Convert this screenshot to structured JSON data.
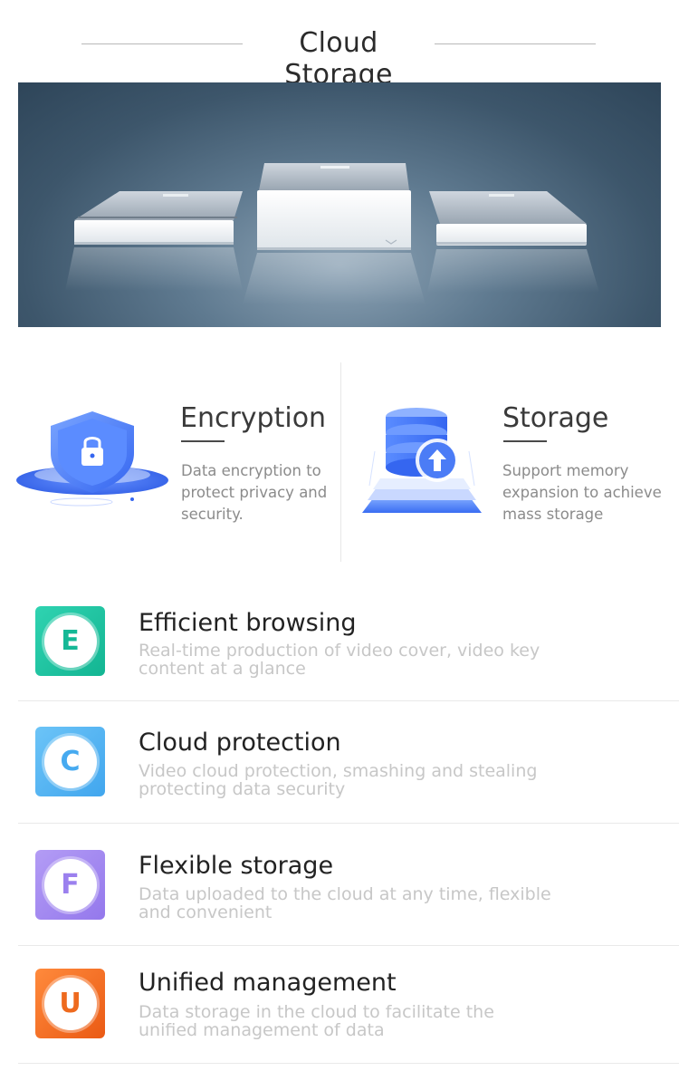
{
  "header": {
    "title": "Cloud Storage"
  },
  "features": [
    {
      "title": "Encryption",
      "description": "Data encryption to protect privacy and security.",
      "icon": "shield-lock-icon"
    },
    {
      "title": "Storage",
      "description": "Support memory expansion to achieve mass storage",
      "icon": "database-upload-icon"
    }
  ],
  "items": [
    {
      "letter": "E",
      "title": "Efficient browsing",
      "description": "Real-time production of video cover, video key content at a glance",
      "color": "#1fc4a0"
    },
    {
      "letter": "C",
      "title": "Cloud protection",
      "description": "Video cloud protection, smashing and stealing protecting data security",
      "color": "#58b4f0"
    },
    {
      "letter": "F",
      "title": "Flexible storage",
      "description": "Data uploaded to the cloud at any time, flexible and convenient",
      "color": "#a78cf0"
    },
    {
      "letter": "U",
      "title": "Unified management",
      "description": "Data storage in the cloud to facilitate the unified management of data",
      "color": "#f0641e"
    }
  ],
  "colors": {
    "accent_blue": "#4b7cf6"
  }
}
